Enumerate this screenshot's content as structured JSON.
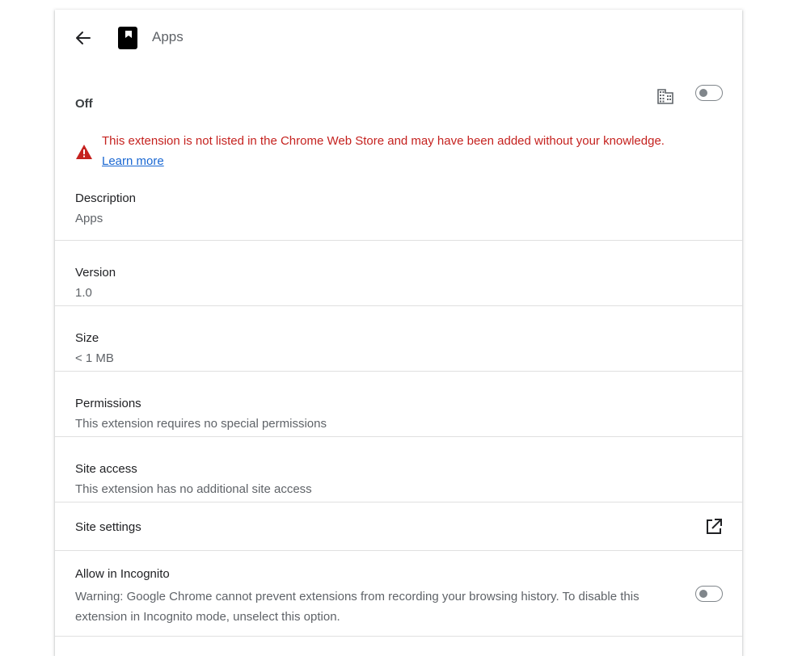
{
  "header": {
    "title": "Apps",
    "back_icon": "arrow-back-icon",
    "app_icon": "apps-extension-icon"
  },
  "enable_row": {
    "label": "Off",
    "enterprise_icon": "building-icon",
    "toggle_state": "off"
  },
  "warning": {
    "icon": "warning-triangle-icon",
    "text": "This extension is not listed in the Chrome Web Store and may have been added without your knowledge.",
    "link": "Learn more",
    "color": "#c5221f"
  },
  "description": {
    "label": "Description",
    "value": "Apps"
  },
  "version": {
    "label": "Version",
    "value": "1.0"
  },
  "size": {
    "label": "Size",
    "value": "< 1 MB"
  },
  "permissions": {
    "label": "Permissions",
    "value": "This extension requires no special permissions"
  },
  "site_access": {
    "label": "Site access",
    "value": "This extension has no additional site access"
  },
  "site_settings": {
    "label": "Site settings",
    "icon": "open-in-new-icon"
  },
  "incognito": {
    "label": "Allow in Incognito",
    "warning": "Warning: Google Chrome cannot prevent extensions from recording your browsing history. To disable this extension in Incognito mode, unselect this option.",
    "toggle_state": "off"
  },
  "colors": {
    "link": "#1967d2",
    "secondary_text": "#5f6368",
    "divider": "#e0e0e0"
  }
}
